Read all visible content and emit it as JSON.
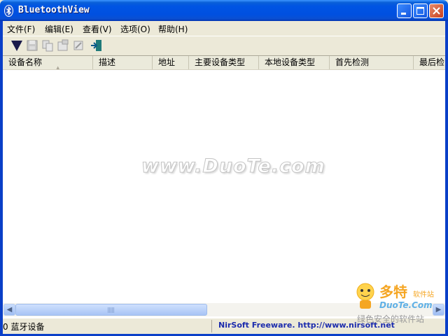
{
  "window": {
    "title": "BluetoothView",
    "colors": {
      "titlebar": "#0054e3",
      "frame": "#0a3fc8",
      "link": "#1c2cad"
    }
  },
  "menu": [
    {
      "label": "文件(F)"
    },
    {
      "label": "编辑(E)"
    },
    {
      "label": "查看(V)"
    },
    {
      "label": "选项(O)"
    },
    {
      "label": "帮助(H)"
    }
  ],
  "toolbar": {
    "icons": [
      "start-stop-icon",
      "save-icon",
      "copy-icon",
      "properties-icon",
      "refresh-icon",
      "exit-icon"
    ]
  },
  "list": {
    "columns": [
      "设备名称",
      "描述",
      "地址",
      "主要设备类型",
      "本地设备类型",
      "首先检测",
      "最后检"
    ],
    "sort_column": "设备名称",
    "rows": []
  },
  "watermark": "www.DuoTe.com",
  "status": {
    "count": "0 蓝牙设备",
    "link": "NirSoft Freeware.  http://www.nirsoft.net"
  },
  "logo": {
    "cn": "多特",
    "sub": "软件站",
    "en": "DuoTe.Com",
    "tag": "绿色安全的软件站"
  }
}
